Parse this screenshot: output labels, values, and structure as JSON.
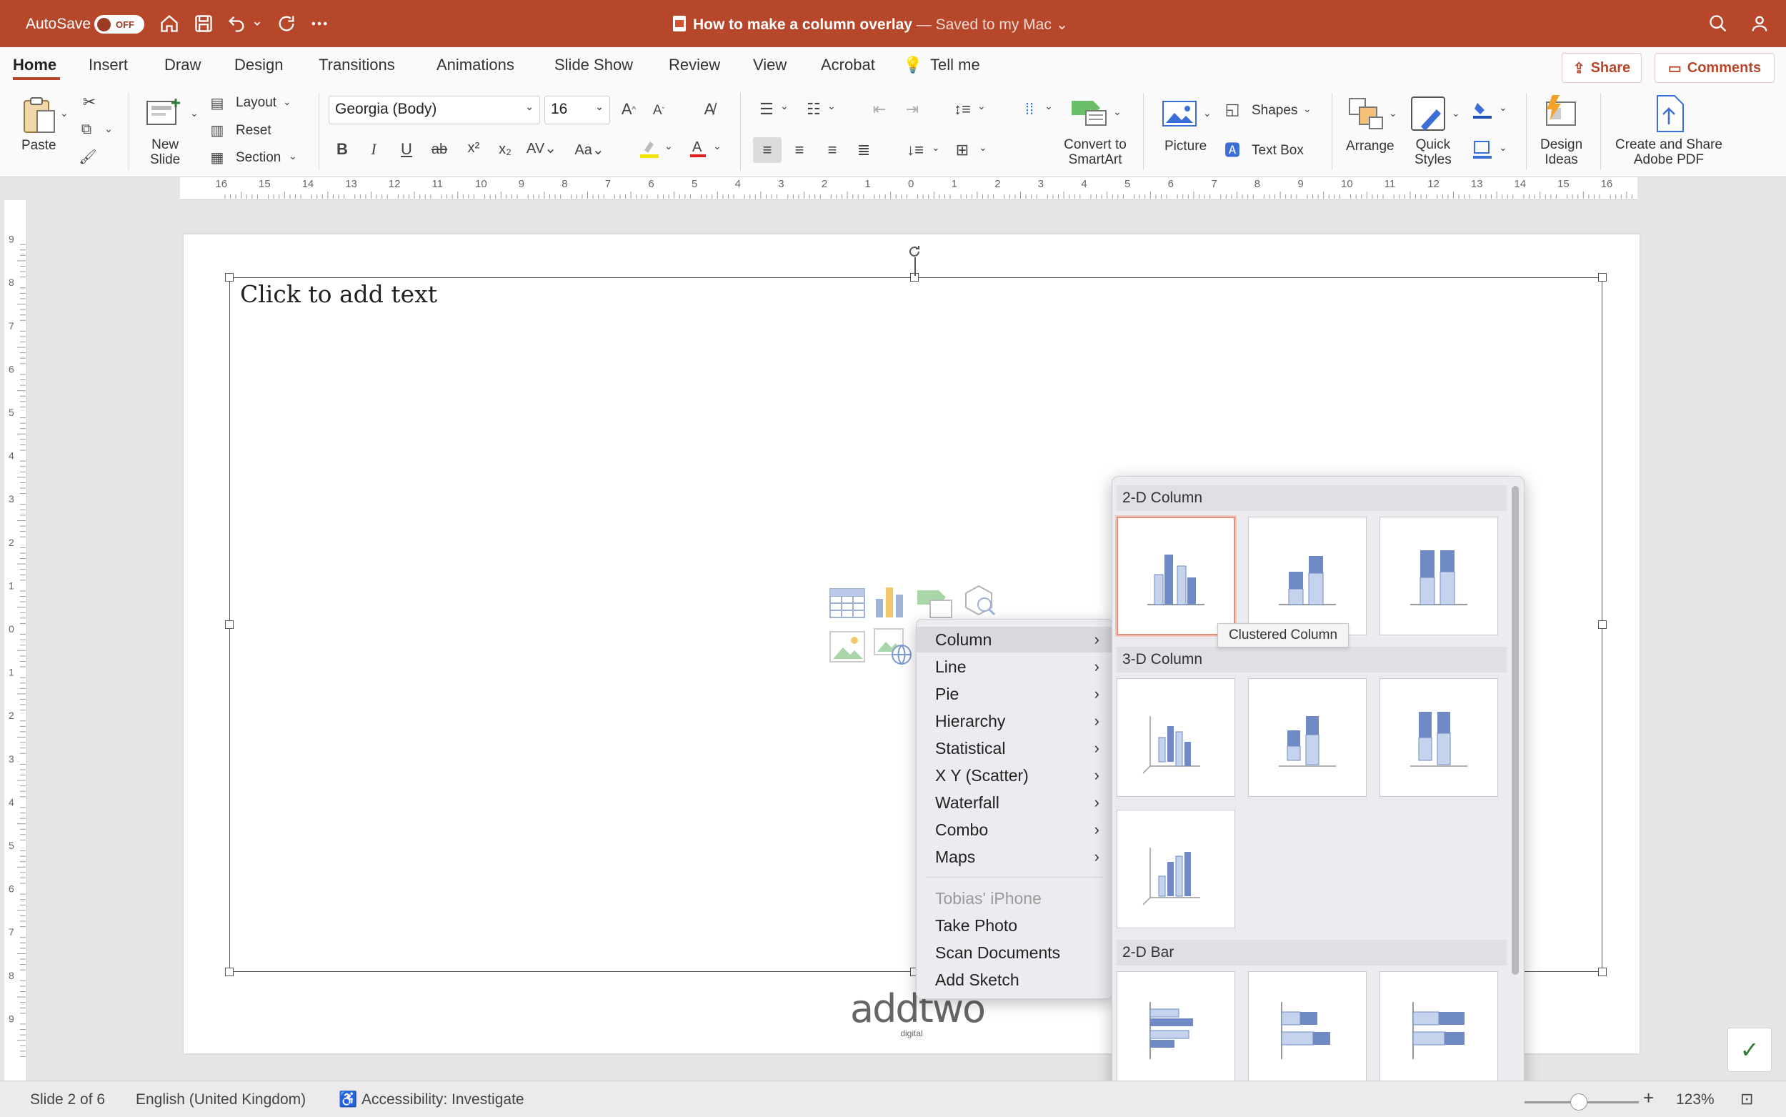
{
  "titlebar": {
    "autosave_label": "AutoSave",
    "autosave_state": "OFF",
    "doc_name": "How to make a column overlay",
    "saved_status": " — Saved to my Mac",
    "icons": [
      "home-icon",
      "save-icon",
      "undo-icon",
      "redo-icon",
      "more-icon",
      "search-icon",
      "account-icon"
    ]
  },
  "tabs": [
    "Home",
    "Insert",
    "Draw",
    "Design",
    "Transitions",
    "Animations",
    "Slide Show",
    "Review",
    "View",
    "Acrobat",
    "Tell me"
  ],
  "share_label": "Share",
  "comments_label": "Comments",
  "ribbon": {
    "paste": "Paste",
    "new_slide": [
      "New",
      "Slide"
    ],
    "layout": "Layout",
    "reset": "Reset",
    "section": "Section",
    "font_name": "Georgia (Body)",
    "font_size": "16",
    "convert_smartart": [
      "Convert to",
      "SmartArt"
    ],
    "picture": "Picture",
    "shapes": "Shapes",
    "text_box": "Text Box",
    "arrange": "Arrange",
    "quick_styles": [
      "Quick",
      "Styles"
    ],
    "design_ideas": [
      "Design",
      "Ideas"
    ],
    "create_share_pdf": [
      "Create and Share",
      "Adobe PDF"
    ],
    "format_buttons": [
      "B",
      "I",
      "U",
      "ab",
      "x²",
      "x₂"
    ]
  },
  "slide": {
    "placeholder_text": "Click to add text",
    "logo_text": "addtwo",
    "logo_sub": "digital"
  },
  "context_menu": {
    "items": [
      {
        "label": "Column",
        "submenu": true,
        "highlighted": true
      },
      {
        "label": "Line",
        "submenu": true
      },
      {
        "label": "Pie",
        "submenu": true
      },
      {
        "label": "Hierarchy",
        "submenu": true
      },
      {
        "label": "Statistical",
        "submenu": true
      },
      {
        "label": "X Y (Scatter)",
        "submenu": true
      },
      {
        "label": "Waterfall",
        "submenu": true
      },
      {
        "label": "Combo",
        "submenu": true
      },
      {
        "label": "Maps",
        "submenu": true
      }
    ],
    "device_header": "Tobias' iPhone",
    "device_items": [
      "Take Photo",
      "Scan Documents",
      "Add Sketch"
    ]
  },
  "gallery": {
    "sections": [
      "2-D Column",
      "3-D Column",
      "2-D Bar"
    ],
    "tooltip": "Clustered Column",
    "selected": "Clustered Column"
  },
  "statusbar": {
    "slide_info": "Slide 2 of 6",
    "language": "English (United Kingdom)",
    "accessibility": "Accessibility: Investigate",
    "zoom": "123%"
  },
  "colors": {
    "accent": "#b7472a",
    "chart_dark": "#6f8ac4",
    "chart_light": "#c6d3ec"
  }
}
